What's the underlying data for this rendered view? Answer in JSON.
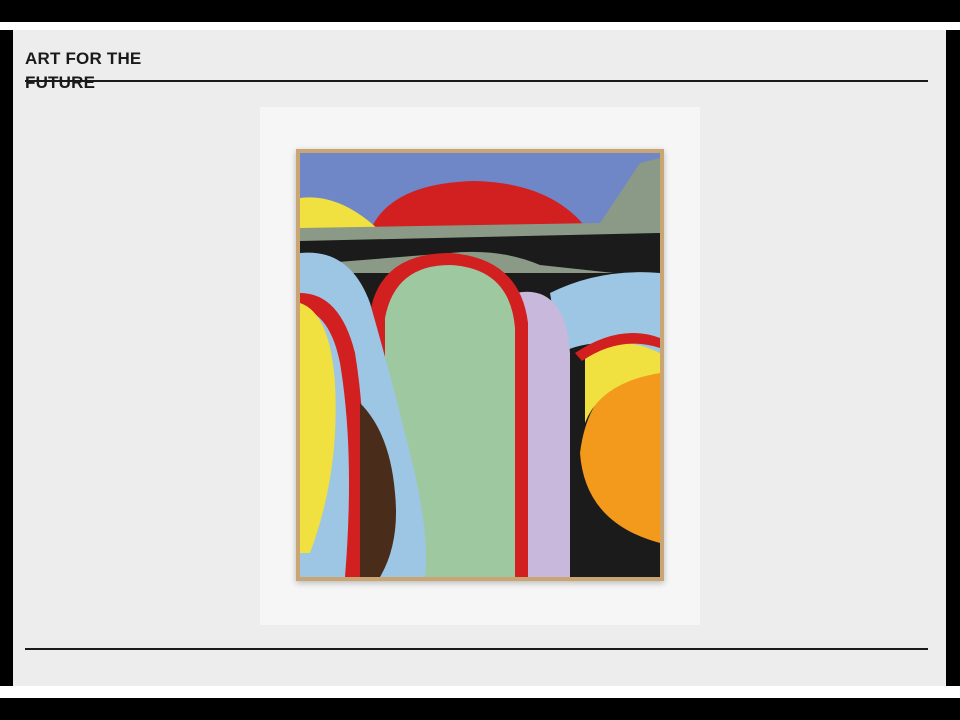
{
  "slide": {
    "title": "ART FOR THE FUTURE"
  },
  "artwork": {
    "frame_color": "#c9a574",
    "palette": {
      "sky": "#6f86c7",
      "red": "#d21f1f",
      "yellow": "#f0e040",
      "light_blue": "#9cc6e4",
      "sage_green": "#9ec8a0",
      "lavender": "#c8b8dc",
      "orange": "#f39a1c",
      "dark": "#1b1b1b",
      "gray_green": "#8a9a86",
      "brown": "#4a2c1a"
    }
  }
}
